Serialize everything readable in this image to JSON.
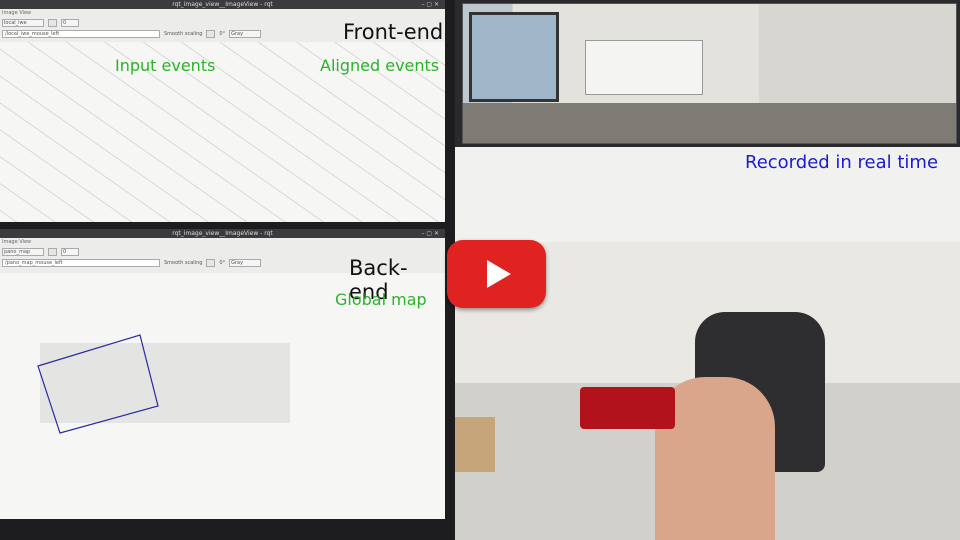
{
  "front_window": {
    "title": "rqt_image_view__ImageView - rqt",
    "subtitle": "Image View",
    "topic_select": "local_iwe",
    "topic_input": "/local_iwe_mouse_left",
    "smooth_scaling": "Smooth scaling",
    "rotation": "0°",
    "color_mode": "Gray",
    "spin_value": "0",
    "label": "Front-end",
    "annotations": [
      "Input events",
      "Aligned events"
    ]
  },
  "back_window": {
    "title": "rqt_image_view__ImageView - rqt",
    "subtitle": "Image View",
    "topic_select": "pano_map",
    "topic_input": "/pano_map_mouse_left",
    "smooth_scaling": "Smooth scaling",
    "rotation": "0°",
    "color_mode": "Gray",
    "spin_value": "0",
    "label": "Back-end",
    "annotations": [
      "Global map"
    ]
  },
  "scene": {
    "caption": "Recorded in real time"
  },
  "colors": {
    "annotation_green": "#2bb32b",
    "caption_blue": "#1a1ad4",
    "play_red": "#e02220",
    "map_outline": "#2a2aa0"
  },
  "icons": [
    "play-button-icon"
  ]
}
